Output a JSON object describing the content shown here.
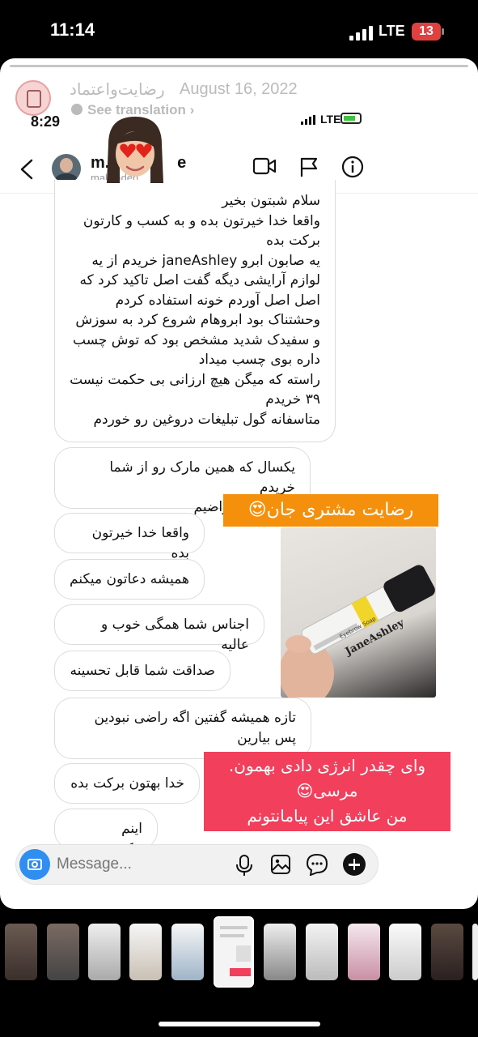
{
  "status_bar": {
    "time": "11:14",
    "network": "LTE",
    "battery": "13"
  },
  "story": {
    "username": "رضایت‌واعتماد",
    "date": "August 16, 2022",
    "see_translation": "See translation",
    "close_icon": "close-icon"
  },
  "inner_screenshot": {
    "time": "8:29",
    "network": "LTE",
    "chat_name": "m.m",
    "chat_name_tail": "e",
    "chat_subtitle": "mali      ladeh"
  },
  "messages": [
    "سلام شبتون بخیر\nواقعا خدا خیرتون بده و به کسب و کارتون برکت بده\nیه صابون ابرو janeAshley خریدم از یه لوازم آرایشی دیگه گفت اصل تاکید کرد که اصل اصل  آوردم خونه استفاده کردم وحشتناک  بود ابروهام شروع کرد به سوزش و سفیدک شدید مشخص بود که توش چسب داره بوی چسب میداد\nراسته که میگن هیچ ارزانی  بی حکمت نیست ۳۹ خریدم\nمتاسفانه گول تبلیغات  دروغین  رو خوردم",
    "یکسال که همین مارک رو از شما  خریدم\nخیلی خیلی  راضیم",
    "واقعا خدا خیرتون بده",
    "همیشه دعاتون میکنم",
    "اجناس شما همگی خوب و عالیه",
    "صداقت شما قابل تحسینه",
    "تازه همیشه گفتین اگه راضی نبودین پس بیارین",
    "خدا بهتون برکت بده",
    "اینم عکسشه"
  ],
  "stickers": {
    "orange": "رضایت مشتری جان😍",
    "pink": "وای  چقدر انرژی دادی بهمون.\nمرسی😍\nمن عاشق این پیامانتونم"
  },
  "product": {
    "brand_label": "JaneAshley",
    "product_label": "Eyebrow Soap"
  },
  "composer": {
    "placeholder": "Message..."
  },
  "colors": {
    "orange_sticker": "#f5900d",
    "pink_sticker": "#f23f5c",
    "camera": "#2f8ef0",
    "battery_badge": "#e04040"
  }
}
